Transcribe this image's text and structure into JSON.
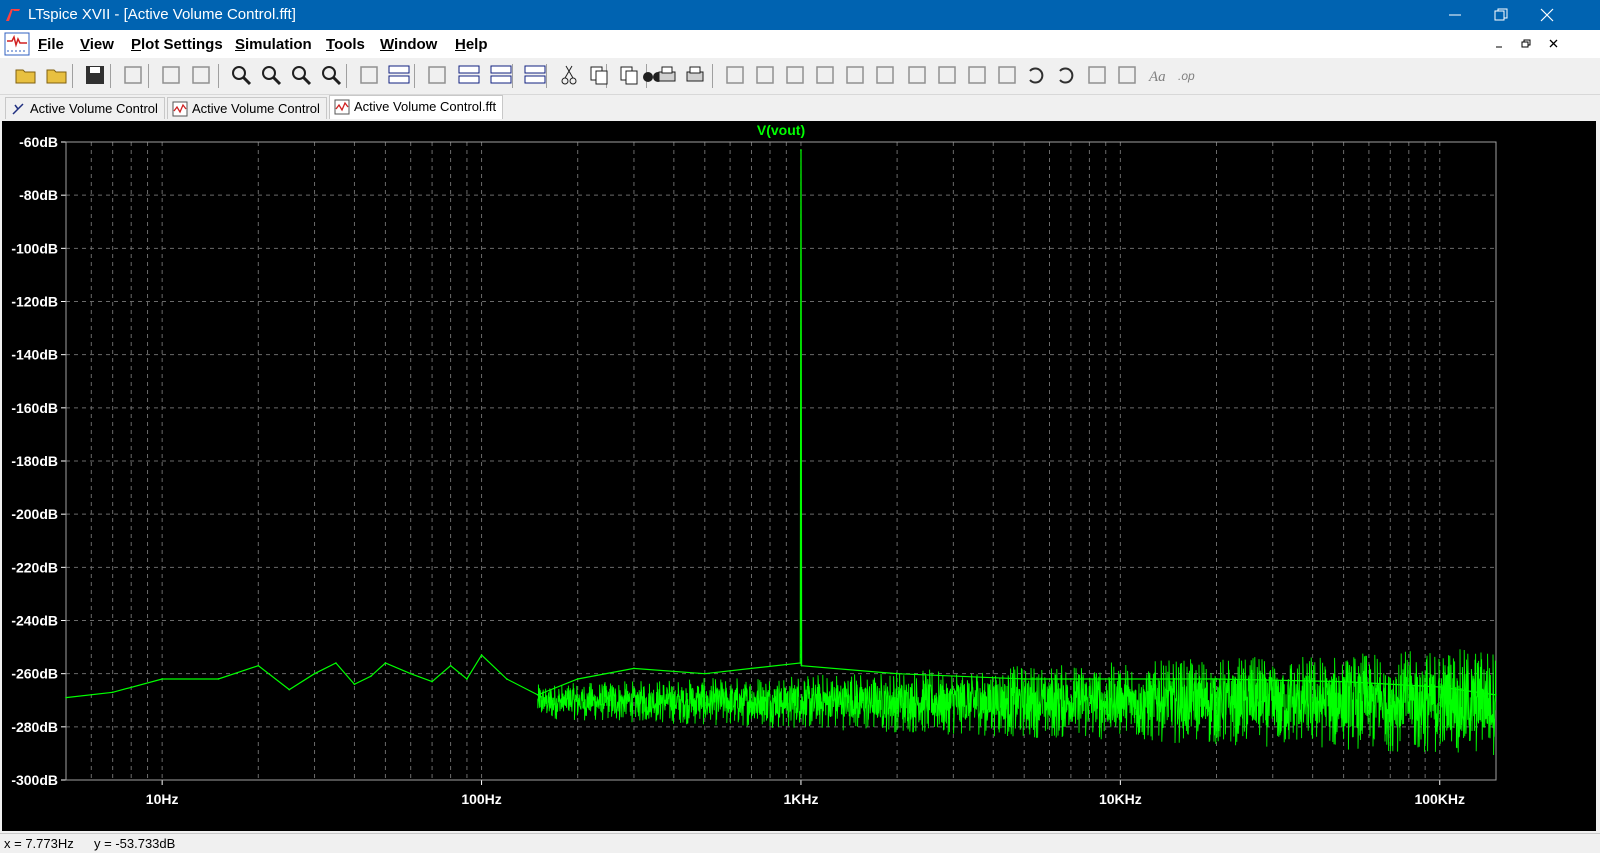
{
  "window": {
    "title": "LTspice XVII - [Active Volume Control.fft]"
  },
  "menubar": {
    "items": [
      "File",
      "View",
      "Plot Settings",
      "Simulation",
      "Tools",
      "Window",
      "Help"
    ]
  },
  "tabs": [
    {
      "label": "Active Volume Control",
      "icon": "schematic-icon",
      "active": false
    },
    {
      "label": "Active Volume Control",
      "icon": "waveform-icon",
      "active": false
    },
    {
      "label": "Active Volume Control.fft",
      "icon": "waveform-icon",
      "active": true
    }
  ],
  "toolbar": {
    "icons": [
      "open-schematic-icon",
      "open-file-icon",
      "save-icon",
      "settings-hammer-icon",
      "run-icon",
      "halt-icon",
      "zoom-in-icon",
      "zoom-area-icon",
      "zoom-out-icon",
      "zoom-cancel-icon",
      "autorange-icon",
      "plot-pane-icon",
      "add-trace-icon",
      "tile-horizontal-icon",
      "tile-vertical-icon",
      "cascade-icon",
      "cut-icon",
      "copy-icon",
      "paste-icon",
      "find-icon",
      "print-icon",
      "print-setup-icon",
      "wire-icon",
      "ground-icon",
      "label-icon",
      "resistor-icon",
      "capacitor-icon",
      "inductor-icon",
      "diode-icon",
      "component-icon",
      "move-icon",
      "drag-icon",
      "undo-icon",
      "redo-icon",
      "rotate-icon",
      "mirror-icon",
      "text-icon",
      "spice-directive-icon"
    ]
  },
  "chart_data": {
    "type": "line",
    "title": "V(vout)",
    "x_scale": "log",
    "xlim": [
      5,
      150000
    ],
    "ylim": [
      -300,
      -60
    ],
    "y_ticks": [
      -60,
      -80,
      -100,
      -120,
      -140,
      -160,
      -180,
      -200,
      -220,
      -240,
      -260,
      -280,
      -300
    ],
    "y_tick_labels": [
      "-60dB",
      "-80dB",
      "-100dB",
      "-120dB",
      "-140dB",
      "-160dB",
      "-180dB",
      "-200dB",
      "-220dB",
      "-240dB",
      "-260dB",
      "-280dB",
      "-300dB"
    ],
    "x_ticks": [
      10,
      100,
      1000,
      10000,
      100000
    ],
    "x_tick_labels": [
      "10Hz",
      "100Hz",
      "1KHz",
      "10KHz",
      "100KHz"
    ],
    "grid": true,
    "series": [
      {
        "name": "V(vout)",
        "color": "#00ff00",
        "x": [
          5,
          7,
          10,
          15,
          20,
          25,
          30,
          35,
          40,
          45,
          50,
          60,
          70,
          80,
          90,
          100,
          120,
          150,
          200,
          300,
          500,
          700,
          995,
          1000,
          1005,
          2000,
          5000,
          10000,
          20000,
          50000,
          100000,
          150000
        ],
        "y": [
          -269,
          -267,
          -262,
          -262,
          -257,
          -266,
          -260,
          -256,
          -264,
          -261,
          -256,
          -260,
          -263,
          -257,
          -262,
          -253,
          -262,
          -268,
          -262,
          -258,
          -260,
          -258,
          -256,
          -63,
          -257,
          -260,
          -262,
          -262,
          -262,
          -263,
          -265,
          -268
        ],
        "noise_band": {
          "x_start": 150,
          "x_end": 150000,
          "min": -285,
          "max": -248
        }
      }
    ]
  },
  "statusbar": {
    "x_readout": "x = 7.773Hz",
    "y_readout": "y = -53.733dB"
  },
  "colors": {
    "titlebar": "#0063b1",
    "trace": "#00ff00",
    "plot_bg": "#000000",
    "axis_text": "#ffffff"
  }
}
